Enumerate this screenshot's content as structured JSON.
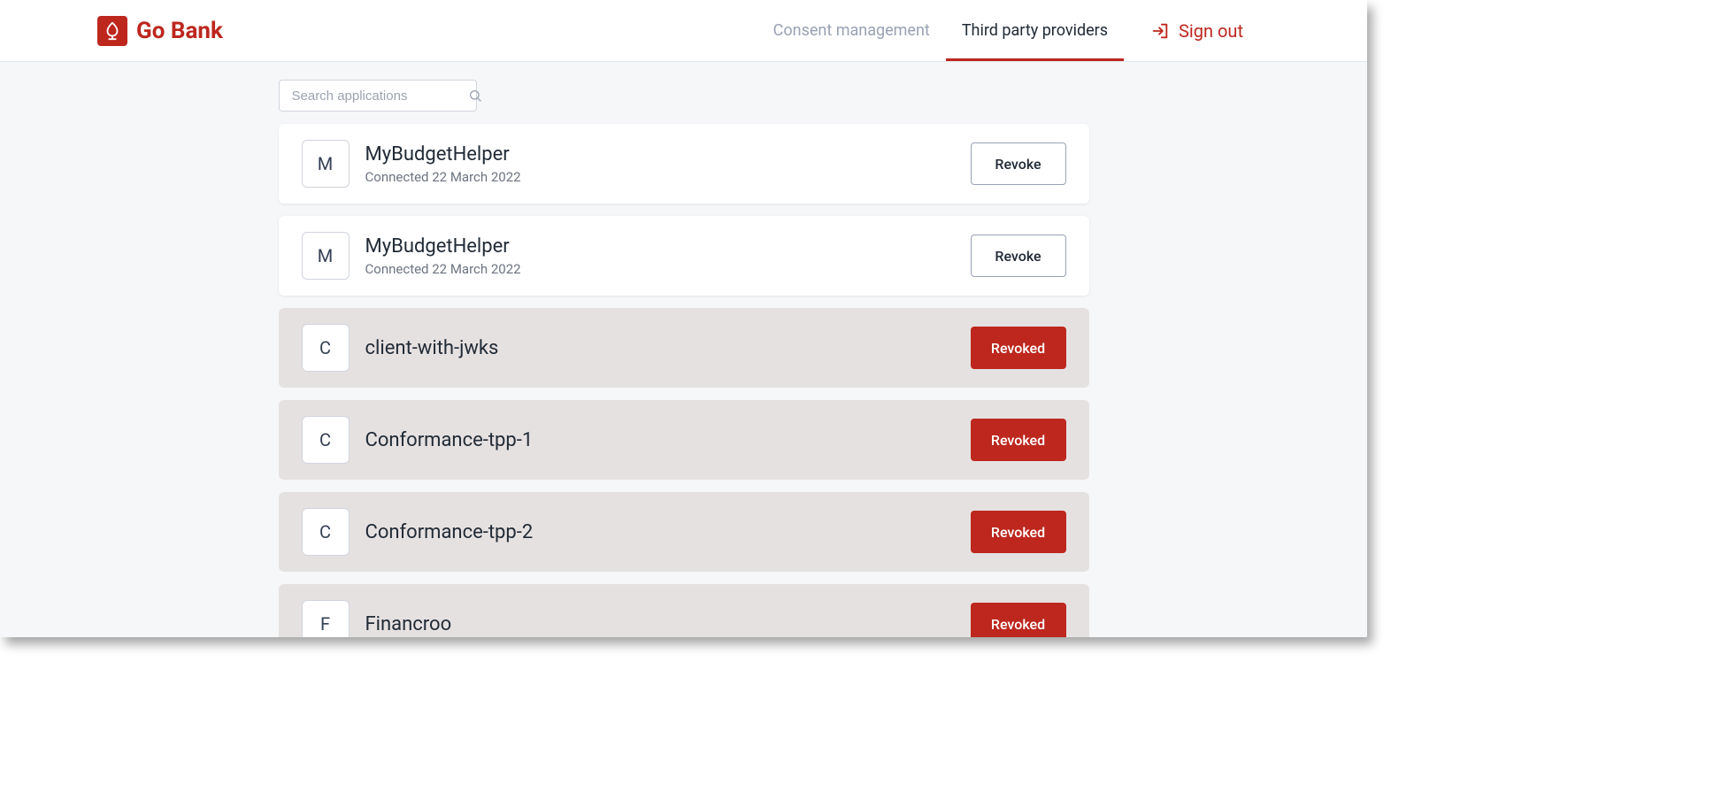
{
  "brand": {
    "name": "Go Bank"
  },
  "nav": {
    "consent": "Consent management",
    "tpp": "Third party providers",
    "signout": "Sign out"
  },
  "search": {
    "placeholder": "Search applications"
  },
  "buttons": {
    "revoke": "Revoke",
    "revoked": "Revoked"
  },
  "apps": [
    {
      "avatar": "M",
      "name": "MyBudgetHelper",
      "sub": "Connected 22 March 2022",
      "status": "active"
    },
    {
      "avatar": "M",
      "name": "MyBudgetHelper",
      "sub": "Connected 22 March 2022",
      "status": "active"
    },
    {
      "avatar": "C",
      "name": "client-with-jwks",
      "sub": "",
      "status": "revoked"
    },
    {
      "avatar": "C",
      "name": "Conformance-tpp-1",
      "sub": "",
      "status": "revoked"
    },
    {
      "avatar": "C",
      "name": "Conformance-tpp-2",
      "sub": "",
      "status": "revoked"
    },
    {
      "avatar": "F",
      "name": "Financroo",
      "sub": "",
      "status": "revoked"
    }
  ]
}
